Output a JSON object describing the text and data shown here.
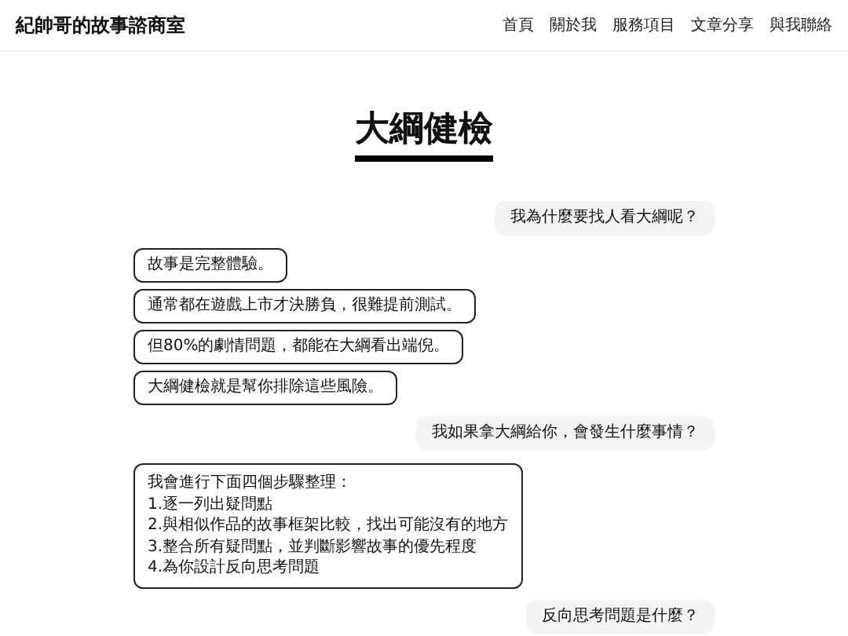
{
  "site": {
    "title": "紀帥哥的故事諮商室"
  },
  "nav": [
    {
      "label": "首頁"
    },
    {
      "label": "關於我"
    },
    {
      "label": "服務項目"
    },
    {
      "label": "文章分享"
    },
    {
      "label": "與我聯絡"
    }
  ],
  "page_title": "大綱健檢",
  "messages": [
    {
      "kind": "question",
      "lines": [
        "我為什麼要找人看大綱呢？"
      ]
    },
    {
      "kind": "answer",
      "lines": [
        "故事是完整體驗。"
      ]
    },
    {
      "kind": "answer",
      "lines": [
        "通常都在遊戲上市才決勝負，很難提前測試。"
      ]
    },
    {
      "kind": "answer",
      "lines": [
        "但80%的劇情問題，都能在大綱看出端倪。"
      ]
    },
    {
      "kind": "answer",
      "lines": [
        "大綱健檢就是幫你排除這些風險。"
      ]
    },
    {
      "kind": "question",
      "lines": [
        "我如果拿大綱給你，會發生什麼事情？"
      ]
    },
    {
      "kind": "answer",
      "lines": [
        "我會進行下面四個步驟整理：",
        "1.逐一列出疑問點",
        "2.與相似作品的故事框架比較，找出可能沒有的地方",
        "3.整合所有疑問點，並判斷影響故事的優先程度",
        "4.為你設計反向思考問題"
      ]
    },
    {
      "kind": "question",
      "lines": [
        "反向思考問題是什麼？"
      ]
    }
  ]
}
